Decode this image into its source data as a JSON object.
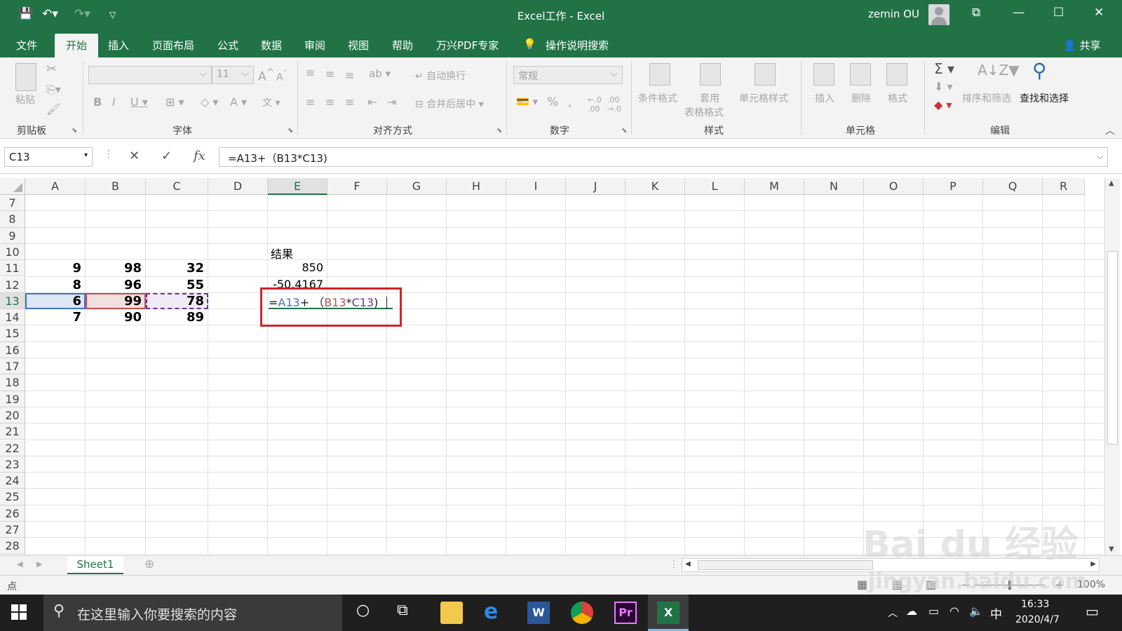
{
  "window": {
    "title": "Excel工作 - Excel",
    "user": "zemin OU"
  },
  "tabs": [
    {
      "label": "文件",
      "active": false
    },
    {
      "label": "开始",
      "active": true
    },
    {
      "label": "插入",
      "active": false
    },
    {
      "label": "页面布局",
      "active": false
    },
    {
      "label": "公式",
      "active": false
    },
    {
      "label": "数据",
      "active": false
    },
    {
      "label": "审阅",
      "active": false
    },
    {
      "label": "视图",
      "active": false
    },
    {
      "label": "帮助",
      "active": false
    },
    {
      "label": "万兴PDF专家",
      "active": false
    }
  ],
  "tell_me": "操作说明搜索",
  "share": "共享",
  "ribbon": {
    "paste": "粘贴",
    "font_size": "11",
    "wrap_text": "自动换行",
    "merge_center": "合并后居中",
    "number_format": "常规",
    "conditional_format": "条件格式",
    "table_format_1": "套用",
    "table_format_2": "表格格式",
    "cell_styles": "单元格样式",
    "insert": "插入",
    "delete": "删除",
    "format": "格式",
    "sort_filter": "排序和筛选",
    "find_select": "查找和选择",
    "groups": {
      "clipboard": "剪贴板",
      "font": "字体",
      "alignment": "对齐方式",
      "number": "数字",
      "styles": "样式",
      "cells": "单元格",
      "editing": "编辑"
    }
  },
  "formula_bar": {
    "name_box": "C13",
    "fx": "fx",
    "formula": "=A13+（B13*C13)"
  },
  "columns": [
    "A",
    "B",
    "C",
    "D",
    "E",
    "F",
    "G",
    "H",
    "I",
    "J",
    "K",
    "L",
    "M",
    "N",
    "O",
    "P",
    "Q",
    "R"
  ],
  "rows": [
    "7",
    "8",
    "9",
    "10",
    "11",
    "12",
    "13",
    "14",
    "15",
    "16",
    "17",
    "18",
    "19",
    "20",
    "21",
    "22",
    "23",
    "24",
    "25",
    "26",
    "27",
    "28"
  ],
  "cells": {
    "e10": "结果",
    "a11": "9",
    "b11": "98",
    "c11": "32",
    "e11": "850",
    "a12": "8",
    "b12": "96",
    "c12": "55",
    "e12": "-50.4167",
    "a13": "6",
    "b13": "99",
    "c13": "78",
    "a14": "7",
    "b14": "90",
    "c14": "89"
  },
  "edit": {
    "eq": "=",
    "ref1": "A13",
    "plus": "+ （",
    "ref2": "B13",
    "star": "*",
    "ref3": "C13",
    "close": ")"
  },
  "sheet_tab": "Sheet1",
  "status": {
    "mode": "点",
    "zoom": "100%"
  },
  "taskbar": {
    "search": "在这里输入你要搜索的内容",
    "time": "16:33",
    "date": "2020/4/7",
    "ime": "中"
  },
  "watermark": {
    "brand": "Bai du 经验",
    "url": "jingyan.baidu.com"
  },
  "colors": {
    "excel_green": "#217346",
    "ref_blue": "#4472c4",
    "ref_red": "#c0504d",
    "ref_purple": "#7030a0",
    "highlight": "#d0242b"
  }
}
